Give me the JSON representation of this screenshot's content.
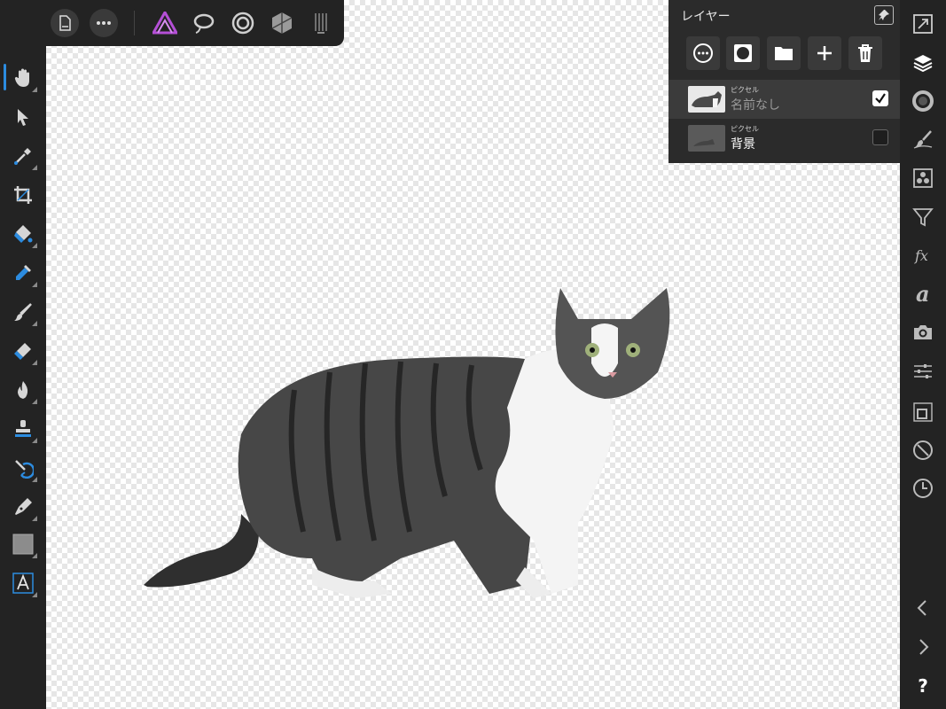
{
  "layers_panel": {
    "title": "レイヤー",
    "layers": [
      {
        "type_label": "ピクセル",
        "name": "名前なし",
        "visible": true
      },
      {
        "type_label": "ピクセル",
        "name": "背景",
        "visible": false
      }
    ]
  },
  "top_toolbar": {
    "icons": [
      "back-icon",
      "document-icon",
      "more-icon",
      "photo-persona-icon",
      "liquify-persona-icon",
      "develop-persona-icon",
      "tone-mapping-persona-icon",
      "export-persona-icon"
    ]
  },
  "left_toolbar": {
    "tools": [
      "view-tool",
      "move-tool",
      "color-picker-tool",
      "crop-tool",
      "flood-fill-tool",
      "selection-brush-tool",
      "paint-brush-tool",
      "erase-brush-tool",
      "dodge-brush-tool",
      "clone-brush-tool",
      "healing-brush-tool",
      "pen-tool",
      "rectangle-tool",
      "text-tool"
    ]
  },
  "right_toolbar": {
    "icons": [
      "full-screen-icon",
      "layers-icon",
      "color-icon",
      "brushes-icon",
      "channels-icon",
      "filters-icon",
      "effects-icon",
      "text-styles-icon",
      "stock-icon",
      "adjustments-icon",
      "transform-icon",
      "navigator-icon",
      "history-icon",
      "undo-icon",
      "redo-icon",
      "help-icon"
    ],
    "help_label": "?"
  },
  "colors": {
    "accent": "#2c8ce0",
    "persona_photo": "#b44fd6",
    "toolbar_bg": "#232323",
    "panel_bg": "#2b2b2b"
  }
}
